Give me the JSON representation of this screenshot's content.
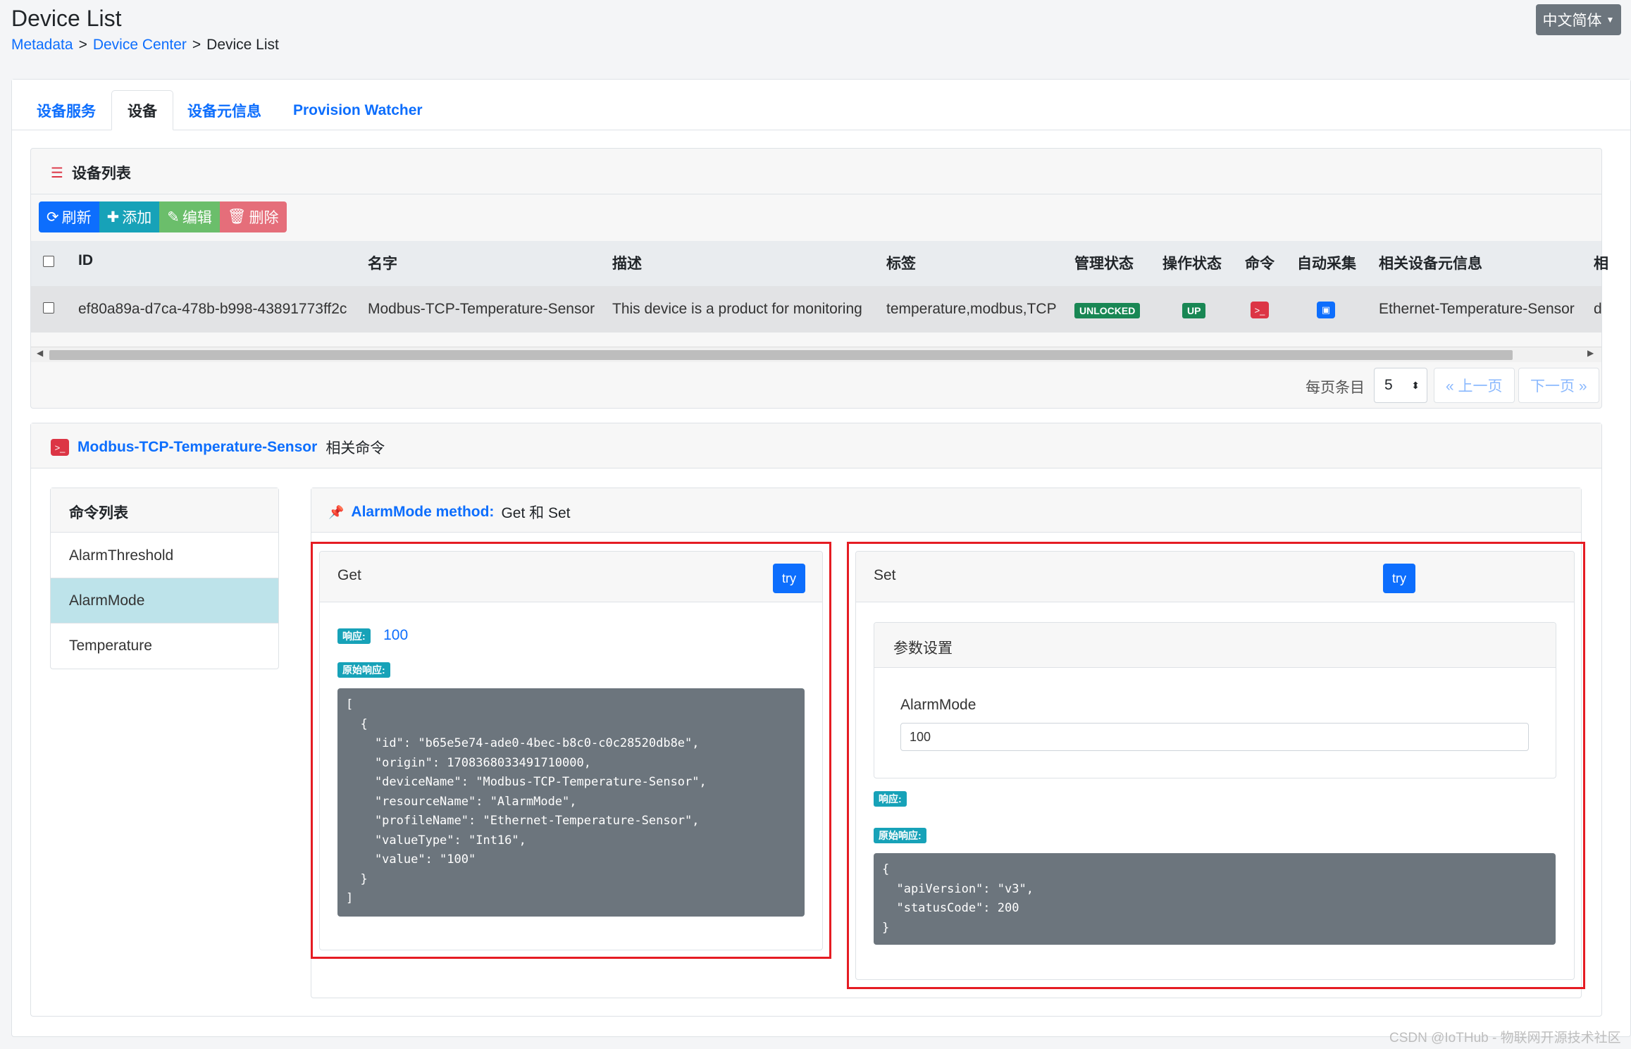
{
  "header": {
    "title": "Device List",
    "breadcrumb": [
      "Metadata",
      "Device Center",
      "Device List"
    ],
    "separator": ">",
    "lang_label": "中文简体"
  },
  "tabs": [
    {
      "label": "设备服务",
      "active": false
    },
    {
      "label": "设备",
      "active": true
    },
    {
      "label": "设备元信息",
      "active": false
    },
    {
      "label": "Provision Watcher",
      "active": false
    }
  ],
  "device_list": {
    "title": "设备列表",
    "toolbar": {
      "refresh": "刷新",
      "add": "添加",
      "edit": "编辑",
      "delete": "删除"
    },
    "columns": [
      "ID",
      "名字",
      "描述",
      "标签",
      "管理状态",
      "操作状态",
      "命令",
      "自动采集",
      "相关设备元信息",
      "相"
    ],
    "rows": [
      {
        "id": "ef80a89a-d7ca-478b-b998-43891773ff2c",
        "name": "Modbus-TCP-Temperature-Sensor",
        "description": "This device is a product for monitoring",
        "labels": "temperature,modbus,TCP",
        "admin_state": "UNLOCKED",
        "operating_state": "UP",
        "command_icon": "terminal-icon",
        "autoevent_icon": "calendar-icon",
        "profile": "Ethernet-Temperature-Sensor",
        "extra": "d"
      }
    ],
    "pager": {
      "per_page_label": "每页条目",
      "per_page_value": "5",
      "prev": "« 上一页",
      "next": "下一页 »"
    }
  },
  "commands": {
    "device_name": "Modbus-TCP-Temperature-Sensor",
    "title_suffix": "相关命令",
    "list_title": "命令列表",
    "items": [
      "AlarmThreshold",
      "AlarmMode",
      "Temperature"
    ],
    "active_item": "AlarmMode",
    "method": {
      "label": "AlarmMode method:",
      "value": "Get 和 Set"
    },
    "get": {
      "title": "Get",
      "try": "try",
      "response_label": "响应:",
      "response_value": "100",
      "raw_label": "原始响应:",
      "raw": "[\n  {\n    \"id\": \"b65e5e74-ade0-4bec-b8c0-c0c28520db8e\",\n    \"origin\": 1708368033491710000,\n    \"deviceName\": \"Modbus-TCP-Temperature-Sensor\",\n    \"resourceName\": \"AlarmMode\",\n    \"profileName\": \"Ethernet-Temperature-Sensor\",\n    \"valueType\": \"Int16\",\n    \"value\": \"100\"\n  }\n]"
    },
    "set": {
      "title": "Set",
      "try": "try",
      "params_title": "参数设置",
      "param_label": "AlarmMode",
      "param_value": "100",
      "response_label": "响应:",
      "raw_label": "原始响应:",
      "raw": "{\n  \"apiVersion\": \"v3\",\n  \"statusCode\": 200\n}"
    }
  },
  "colors": {
    "primary": "#0d6efd",
    "info": "#17a2b8",
    "success": "#198754",
    "danger": "#dc3545",
    "highlight_frame": "#e51c23"
  },
  "watermark": "CSDN @IoTHub - 物联网开源技术社区"
}
